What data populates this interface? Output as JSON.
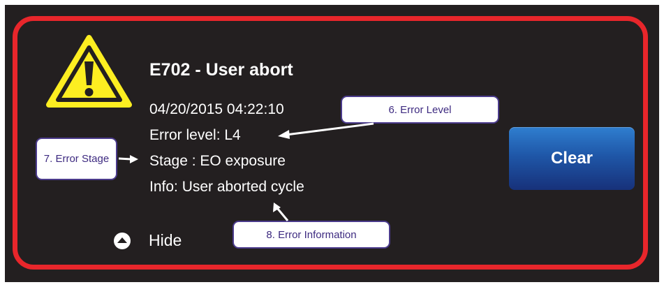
{
  "dialog": {
    "title": "E702 - User abort",
    "timestamp": "04/20/2015 04:22:10",
    "error_level": "Error level: L4",
    "stage": "Stage : EO exposure",
    "info": "Info: User aborted cycle",
    "hide_label": "Hide",
    "clear_label": "Clear",
    "warning_icon": "warning-triangle-icon",
    "hide_icon": "chevron-up-circle-icon"
  },
  "callouts": {
    "error_level": "6. Error Level",
    "error_stage": "7. Error Stage",
    "error_information": "8. Error Information"
  },
  "colors": {
    "background": "#231f20",
    "frame_border": "#e8262b",
    "warning_fill": "#fdee21",
    "button_top": "#2f7ecf",
    "button_bottom": "#17317a",
    "callout_border": "#4b3b8c",
    "callout_text": "#3d2a80"
  }
}
